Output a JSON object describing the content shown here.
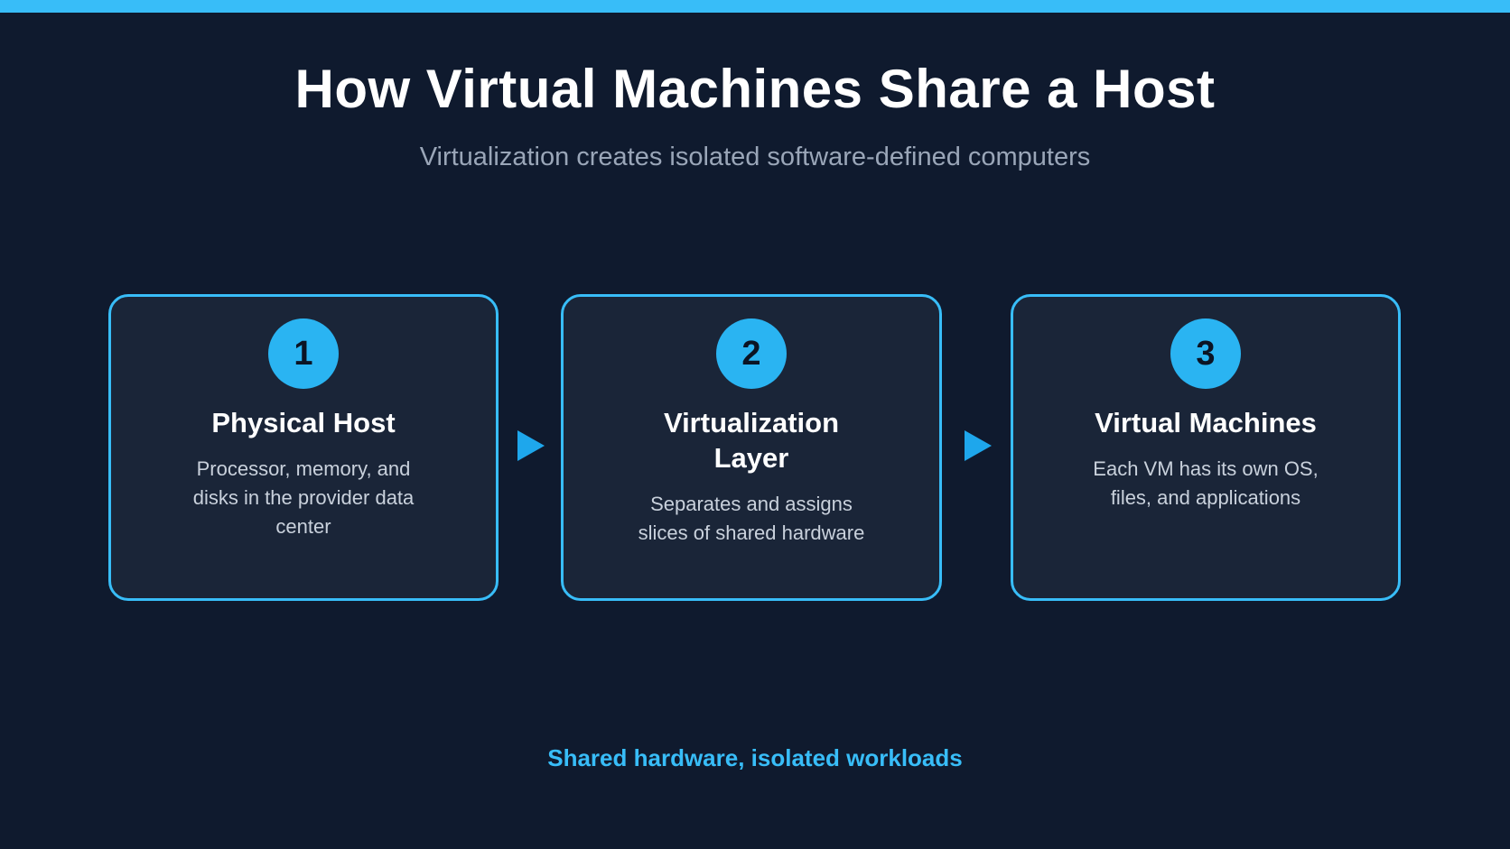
{
  "header": {
    "title": "How Virtual Machines Share a Host",
    "subtitle": "Virtualization creates isolated software-defined computers"
  },
  "steps": [
    {
      "number": "1",
      "title": "Physical Host",
      "description": "Processor, memory, and disks in the provider data center"
    },
    {
      "number": "2",
      "title": "Virtualization Layer",
      "description": "Separates and assigns slices of shared hardware"
    },
    {
      "number": "3",
      "title": "Virtual Machines",
      "description": "Each VM has its own OS, files, and applications"
    }
  ],
  "footer": {
    "tagline": "Shared hardware, isolated workloads"
  },
  "colors": {
    "background": "#0f1a2e",
    "accent": "#38bdf8",
    "card_background": "#1a2538"
  }
}
